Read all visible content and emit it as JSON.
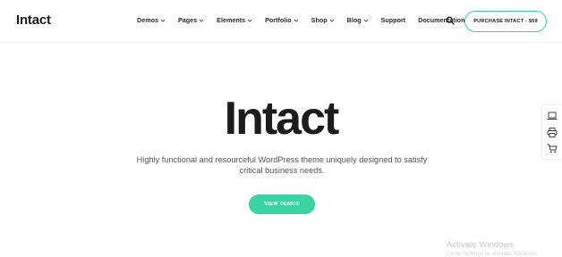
{
  "header": {
    "logo": "Intact",
    "nav": [
      {
        "label": "Demos",
        "dropdown": true
      },
      {
        "label": "Pages",
        "dropdown": true
      },
      {
        "label": "Elements",
        "dropdown": true
      },
      {
        "label": "Portfolio",
        "dropdown": true
      },
      {
        "label": "Shop",
        "dropdown": true
      },
      {
        "label": "Blog",
        "dropdown": true
      },
      {
        "label": "Support",
        "dropdown": false
      },
      {
        "label": "Documentation",
        "dropdown": false
      }
    ],
    "search_icon": "search-icon",
    "purchase_label": "PURCHASE INTACT - $59"
  },
  "hero": {
    "title": "Intact",
    "description_line1": "Highly functional and resourceful WordPress theme uniquely designed to satisfy",
    "description_line2": "critical business needs.",
    "cta_label": "VIEW DEMOS"
  },
  "side_panel": {
    "icons": [
      "laptop-icon",
      "printer-icon",
      "cart-icon"
    ]
  },
  "watermark": {
    "title": "Activate Windows",
    "subtitle": "Go to Settings to activate Windows."
  },
  "colors": {
    "accent": "#3ad3a3",
    "text": "#1c1c1c",
    "muted": "#555555"
  }
}
